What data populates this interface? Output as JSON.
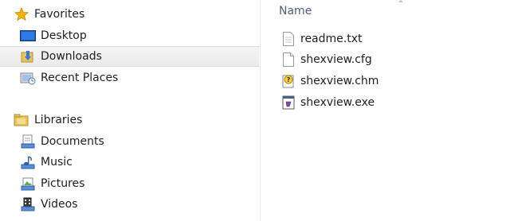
{
  "navigation": {
    "favorites": {
      "label": "Favorites",
      "items": [
        {
          "label": "Desktop",
          "icon": "desktop-icon"
        },
        {
          "label": "Downloads",
          "icon": "downloads-folder-icon",
          "selected": true
        },
        {
          "label": "Recent Places",
          "icon": "recent-places-icon"
        }
      ]
    },
    "libraries": {
      "label": "Libraries",
      "items": [
        {
          "label": "Documents",
          "icon": "documents-library-icon"
        },
        {
          "label": "Music",
          "icon": "music-library-icon"
        },
        {
          "label": "Pictures",
          "icon": "pictures-library-icon"
        },
        {
          "label": "Videos",
          "icon": "videos-library-icon"
        }
      ]
    }
  },
  "file_list": {
    "column_header": "Name",
    "files": [
      {
        "name": "readme.txt",
        "icon": "text-file-icon"
      },
      {
        "name": "shexview.cfg",
        "icon": "config-file-icon"
      },
      {
        "name": "shexview.chm",
        "icon": "help-file-icon"
      },
      {
        "name": "shexview.exe",
        "icon": "executable-file-icon"
      }
    ]
  },
  "colors": {
    "selection": "#eaeaea",
    "header_text": "#4c607a",
    "star": "#f5b400",
    "folder": "#e8c25a"
  }
}
